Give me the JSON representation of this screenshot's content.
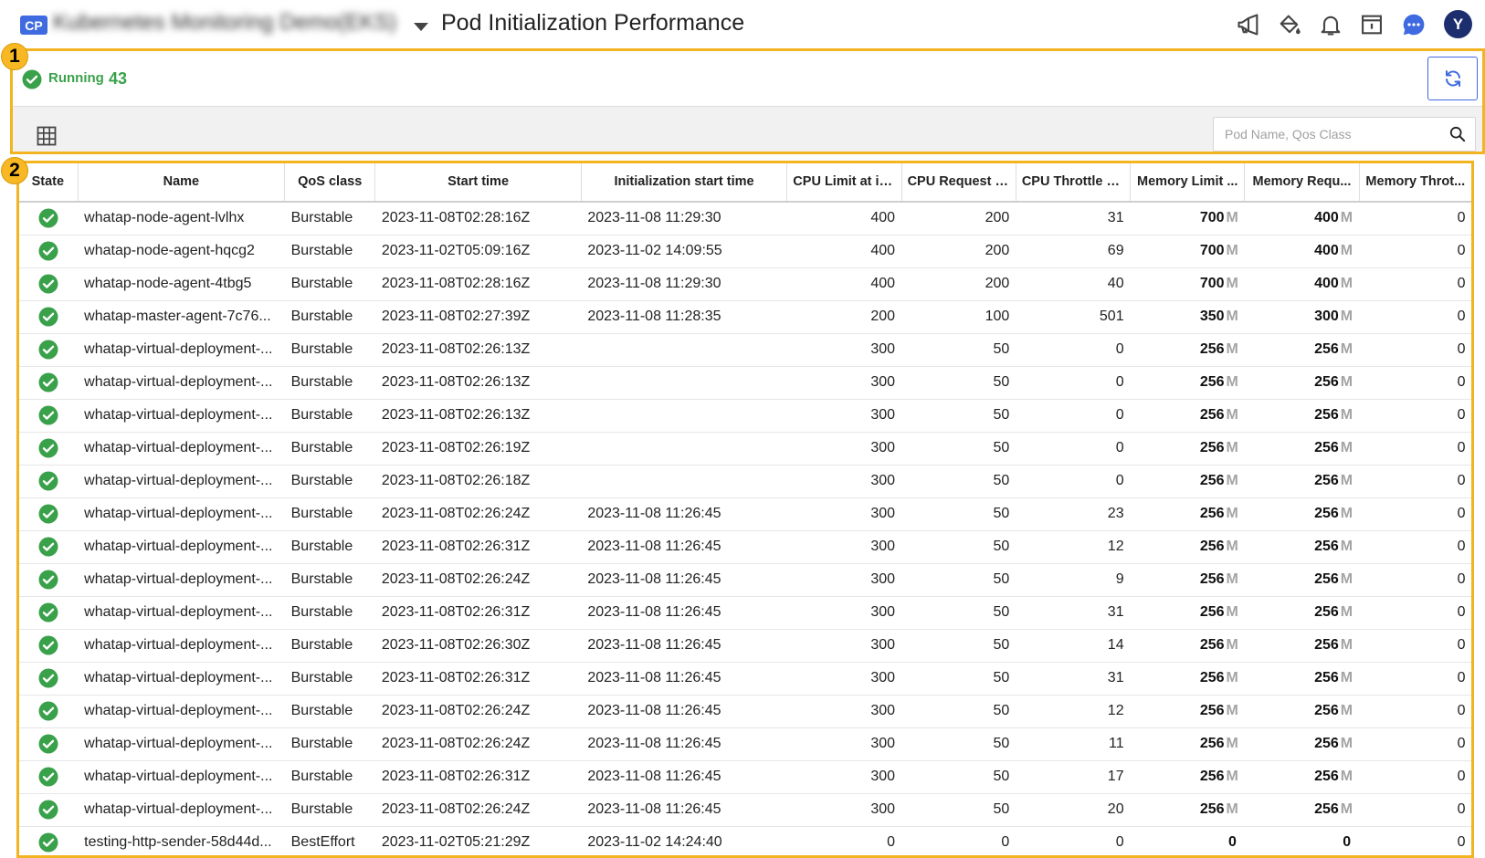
{
  "header": {
    "badge": "CP",
    "project_name": "Kubernetes Monitoring Demo(EKS)",
    "title": "Pod Initialization Performance",
    "icons": [
      "megaphone-icon",
      "paint-bucket-icon",
      "bell-icon",
      "calendar-panel-icon",
      "chat-icon"
    ],
    "avatar_letter": "Y",
    "colors": {
      "badge": "#3f6ae0",
      "chat": "#3f6ae0",
      "avatar": "#1d2e6e"
    }
  },
  "callouts": {
    "first": "1",
    "second": "2",
    "color": "#f2b420"
  },
  "summary": {
    "status_label": "Running",
    "status_count": "43",
    "status_color": "#3aa14b"
  },
  "toolbar": {
    "search_placeholder": "Pod Name, Qos Class",
    "search_value": ""
  },
  "table": {
    "columns": [
      "State",
      "Name",
      "QoS class",
      "Start time",
      "Initialization start time",
      "CPU Limit at in...",
      "CPU Request a...",
      "CPU Throttle a...",
      "Memory Limit ...",
      "Memory Requ...",
      "Memory Throt..."
    ],
    "memory_unit": "M",
    "rows": [
      {
        "state": "running",
        "name": "whatap-node-agent-lvlhx",
        "qos": "Burstable",
        "start": "2023-11-08T02:28:16Z",
        "init": "2023-11-08 11:29:30",
        "cpu_limit": "400",
        "cpu_request": "200",
        "cpu_throttle": "31",
        "mem_limit": "700",
        "mem_request": "400",
        "mem_throttle": "0"
      },
      {
        "state": "running",
        "name": "whatap-node-agent-hqcg2",
        "qos": "Burstable",
        "start": "2023-11-02T05:09:16Z",
        "init": "2023-11-02 14:09:55",
        "cpu_limit": "400",
        "cpu_request": "200",
        "cpu_throttle": "69",
        "mem_limit": "700",
        "mem_request": "400",
        "mem_throttle": "0"
      },
      {
        "state": "running",
        "name": "whatap-node-agent-4tbg5",
        "qos": "Burstable",
        "start": "2023-11-08T02:28:16Z",
        "init": "2023-11-08 11:29:30",
        "cpu_limit": "400",
        "cpu_request": "200",
        "cpu_throttle": "40",
        "mem_limit": "700",
        "mem_request": "400",
        "mem_throttle": "0"
      },
      {
        "state": "running",
        "name": "whatap-master-agent-7c76...",
        "qos": "Burstable",
        "start": "2023-11-08T02:27:39Z",
        "init": "2023-11-08 11:28:35",
        "cpu_limit": "200",
        "cpu_request": "100",
        "cpu_throttle": "501",
        "mem_limit": "350",
        "mem_request": "300",
        "mem_throttle": "0"
      },
      {
        "state": "running",
        "name": "whatap-virtual-deployment-...",
        "qos": "Burstable",
        "start": "2023-11-08T02:26:13Z",
        "init": "",
        "cpu_limit": "300",
        "cpu_request": "50",
        "cpu_throttle": "0",
        "mem_limit": "256",
        "mem_request": "256",
        "mem_throttle": "0"
      },
      {
        "state": "running",
        "name": "whatap-virtual-deployment-...",
        "qos": "Burstable",
        "start": "2023-11-08T02:26:13Z",
        "init": "",
        "cpu_limit": "300",
        "cpu_request": "50",
        "cpu_throttle": "0",
        "mem_limit": "256",
        "mem_request": "256",
        "mem_throttle": "0"
      },
      {
        "state": "running",
        "name": "whatap-virtual-deployment-...",
        "qos": "Burstable",
        "start": "2023-11-08T02:26:13Z",
        "init": "",
        "cpu_limit": "300",
        "cpu_request": "50",
        "cpu_throttle": "0",
        "mem_limit": "256",
        "mem_request": "256",
        "mem_throttle": "0"
      },
      {
        "state": "running",
        "name": "whatap-virtual-deployment-...",
        "qos": "Burstable",
        "start": "2023-11-08T02:26:19Z",
        "init": "",
        "cpu_limit": "300",
        "cpu_request": "50",
        "cpu_throttle": "0",
        "mem_limit": "256",
        "mem_request": "256",
        "mem_throttle": "0"
      },
      {
        "state": "running",
        "name": "whatap-virtual-deployment-...",
        "qos": "Burstable",
        "start": "2023-11-08T02:26:18Z",
        "init": "",
        "cpu_limit": "300",
        "cpu_request": "50",
        "cpu_throttle": "0",
        "mem_limit": "256",
        "mem_request": "256",
        "mem_throttle": "0"
      },
      {
        "state": "running",
        "name": "whatap-virtual-deployment-...",
        "qos": "Burstable",
        "start": "2023-11-08T02:26:24Z",
        "init": "2023-11-08 11:26:45",
        "cpu_limit": "300",
        "cpu_request": "50",
        "cpu_throttle": "23",
        "mem_limit": "256",
        "mem_request": "256",
        "mem_throttle": "0"
      },
      {
        "state": "running",
        "name": "whatap-virtual-deployment-...",
        "qos": "Burstable",
        "start": "2023-11-08T02:26:31Z",
        "init": "2023-11-08 11:26:45",
        "cpu_limit": "300",
        "cpu_request": "50",
        "cpu_throttle": "12",
        "mem_limit": "256",
        "mem_request": "256",
        "mem_throttle": "0"
      },
      {
        "state": "running",
        "name": "whatap-virtual-deployment-...",
        "qos": "Burstable",
        "start": "2023-11-08T02:26:24Z",
        "init": "2023-11-08 11:26:45",
        "cpu_limit": "300",
        "cpu_request": "50",
        "cpu_throttle": "9",
        "mem_limit": "256",
        "mem_request": "256",
        "mem_throttle": "0"
      },
      {
        "state": "running",
        "name": "whatap-virtual-deployment-...",
        "qos": "Burstable",
        "start": "2023-11-08T02:26:31Z",
        "init": "2023-11-08 11:26:45",
        "cpu_limit": "300",
        "cpu_request": "50",
        "cpu_throttle": "31",
        "mem_limit": "256",
        "mem_request": "256",
        "mem_throttle": "0"
      },
      {
        "state": "running",
        "name": "whatap-virtual-deployment-...",
        "qos": "Burstable",
        "start": "2023-11-08T02:26:30Z",
        "init": "2023-11-08 11:26:45",
        "cpu_limit": "300",
        "cpu_request": "50",
        "cpu_throttle": "14",
        "mem_limit": "256",
        "mem_request": "256",
        "mem_throttle": "0"
      },
      {
        "state": "running",
        "name": "whatap-virtual-deployment-...",
        "qos": "Burstable",
        "start": "2023-11-08T02:26:31Z",
        "init": "2023-11-08 11:26:45",
        "cpu_limit": "300",
        "cpu_request": "50",
        "cpu_throttle": "31",
        "mem_limit": "256",
        "mem_request": "256",
        "mem_throttle": "0"
      },
      {
        "state": "running",
        "name": "whatap-virtual-deployment-...",
        "qos": "Burstable",
        "start": "2023-11-08T02:26:24Z",
        "init": "2023-11-08 11:26:45",
        "cpu_limit": "300",
        "cpu_request": "50",
        "cpu_throttle": "12",
        "mem_limit": "256",
        "mem_request": "256",
        "mem_throttle": "0"
      },
      {
        "state": "running",
        "name": "whatap-virtual-deployment-...",
        "qos": "Burstable",
        "start": "2023-11-08T02:26:24Z",
        "init": "2023-11-08 11:26:45",
        "cpu_limit": "300",
        "cpu_request": "50",
        "cpu_throttle": "11",
        "mem_limit": "256",
        "mem_request": "256",
        "mem_throttle": "0"
      },
      {
        "state": "running",
        "name": "whatap-virtual-deployment-...",
        "qos": "Burstable",
        "start": "2023-11-08T02:26:31Z",
        "init": "2023-11-08 11:26:45",
        "cpu_limit": "300",
        "cpu_request": "50",
        "cpu_throttle": "17",
        "mem_limit": "256",
        "mem_request": "256",
        "mem_throttle": "0"
      },
      {
        "state": "running",
        "name": "whatap-virtual-deployment-...",
        "qos": "Burstable",
        "start": "2023-11-08T02:26:24Z",
        "init": "2023-11-08 11:26:45",
        "cpu_limit": "300",
        "cpu_request": "50",
        "cpu_throttle": "20",
        "mem_limit": "256",
        "mem_request": "256",
        "mem_throttle": "0"
      },
      {
        "state": "running",
        "name": "testing-http-sender-58d44d...",
        "qos": "BestEffort",
        "start": "2023-11-02T05:21:29Z",
        "init": "2023-11-02 14:24:40",
        "cpu_limit": "0",
        "cpu_request": "0",
        "cpu_throttle": "0",
        "mem_limit": "0",
        "mem_request": "0",
        "mem_throttle": "0"
      }
    ]
  }
}
